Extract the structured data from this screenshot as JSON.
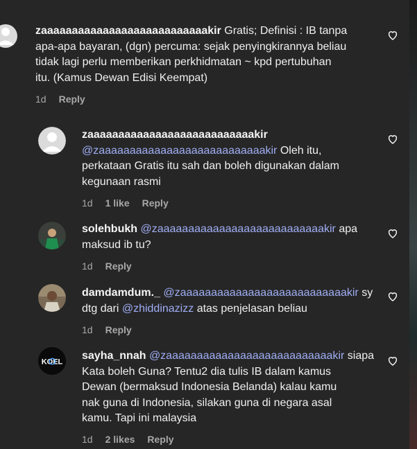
{
  "colors": {
    "background": "#262626",
    "mention": "#a0aef5",
    "meta": "#a8a8a8"
  },
  "comments": [
    {
      "username": "zaaaaaaaaaaaaaaaaaaaaaaaaaaakir",
      "line1_rest": "Gratis; Definisi : IB tanpa",
      "line2": "apa-apa bayaran, (dgn) percuma: sejak penyingkirannya beliau",
      "line3": "tidak lagi perlu memberikan perkhidmatan ~ kpd pertubuhan",
      "line4": "itu. (Kamus Dewan Edisi Keempat)",
      "time": "1d",
      "reply": "Reply",
      "avatar_icon": "default-avatar-icon"
    },
    {
      "username": "zaaaaaaaaaaaaaaaaaaaaaaaaaaakir",
      "mention": "@zaaaaaaaaaaaaaaaaaaaaaaaaaaakir",
      "line2_rest": "Oleh itu,",
      "line3": "perkataan Gratis itu sah dan boleh digunakan dalam",
      "line4": "kegunaan rasmi",
      "time": "1d",
      "likes": "1 like",
      "reply": "Reply",
      "avatar_icon": "default-avatar-icon"
    },
    {
      "username": "solehbukh",
      "mention": "@zaaaaaaaaaaaaaaaaaaaaaaaaaaakir",
      "line1_rest": "apa",
      "line2": "maksud ib tu?",
      "time": "1d",
      "reply": "Reply"
    },
    {
      "username": "damdamdum._",
      "mention": "@zaaaaaaaaaaaaaaaaaaaaaaaaaaakir",
      "line1_rest": "sy",
      "line2_pre": "dtg dari",
      "mention2": "@zhiddinazizz",
      "line2_post": "atas penjelasan beliau",
      "time": "1d",
      "reply": "Reply"
    },
    {
      "username": "sayha_nnah",
      "mention": "@zaaaaaaaaaaaaaaaaaaaaaaaaaaakir",
      "line1_rest": "siapa",
      "line2": "Kata boleh Guna? Tentu2 dia tulis IB dalam kamus",
      "line3": "Dewan (bermaksud Indonesia Belanda) kalau kamu",
      "line4": "nak guna di Indonesia, silakan guna di negara asal",
      "line5": "kamu. Tapi ini malaysia",
      "time": "1d",
      "likes": "2 likes",
      "reply": "Reply",
      "avatar_text": "KOEL"
    }
  ]
}
